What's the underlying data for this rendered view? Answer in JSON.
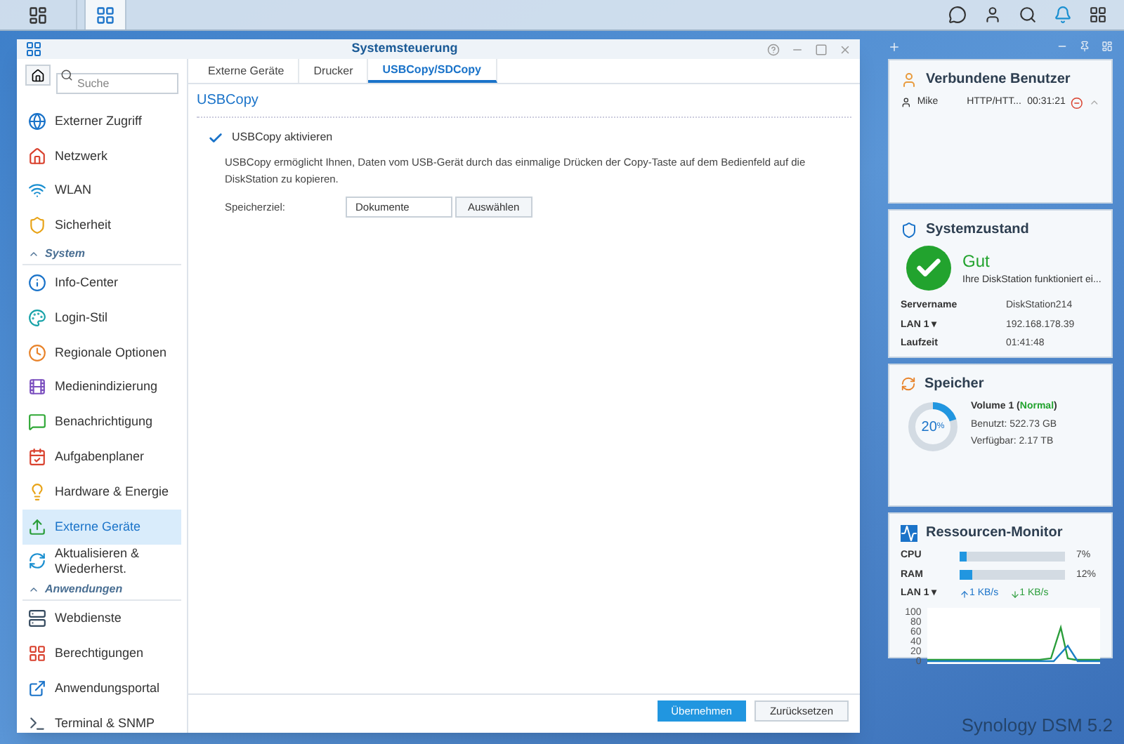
{
  "window": {
    "title": "Systemsteuerung"
  },
  "sidebar": {
    "search": {
      "placeholder": "Suche"
    },
    "items": [
      {
        "kind": "item",
        "label": "Externer Zugriff",
        "selected": false
      },
      {
        "kind": "item",
        "label": "Netzwerk",
        "selected": false
      },
      {
        "kind": "item",
        "label": "WLAN",
        "selected": false
      },
      {
        "kind": "item",
        "label": "Sicherheit",
        "selected": false
      },
      {
        "kind": "section",
        "label": "System"
      },
      {
        "kind": "item",
        "label": "Info-Center",
        "selected": false
      },
      {
        "kind": "item",
        "label": "Login-Stil",
        "selected": false
      },
      {
        "kind": "item",
        "label": "Regionale Optionen",
        "selected": false
      },
      {
        "kind": "item",
        "label": "Medienindizierung",
        "selected": false
      },
      {
        "kind": "item",
        "label": "Benachrichtigung",
        "selected": false
      },
      {
        "kind": "item",
        "label": "Aufgabenplaner",
        "selected": false
      },
      {
        "kind": "item",
        "label": "Hardware & Energie",
        "selected": false
      },
      {
        "kind": "item",
        "label": "Externe Geräte",
        "selected": true
      },
      {
        "kind": "item",
        "label": "Aktualisieren & Wiederherst.",
        "selected": false
      },
      {
        "kind": "section",
        "label": "Anwendungen"
      },
      {
        "kind": "item",
        "label": "Webdienste",
        "selected": false
      },
      {
        "kind": "item",
        "label": "Berechtigungen",
        "selected": false
      },
      {
        "kind": "item",
        "label": "Anwendungsportal",
        "selected": false
      },
      {
        "kind": "item",
        "label": "Terminal & SNMP",
        "selected": false
      }
    ]
  },
  "tabs": [
    {
      "label": "Externe Geräte",
      "selected": false
    },
    {
      "label": "Drucker",
      "selected": false
    },
    {
      "label": "USBCopy/SDCopy",
      "selected": true
    }
  ],
  "section_title": "USBCopy",
  "enable": {
    "label": "USBCopy aktivieren",
    "checked": true
  },
  "description": "USBCopy ermöglicht Ihnen, Daten vom USB-Gerät durch das einmalige Drücken der Copy-Taste auf dem Bedienfeld auf die DiskStation zu kopieren.",
  "destination": {
    "label": "Speicherziel:",
    "value": "Dokumente",
    "button": "Auswählen"
  },
  "buttons": [
    {
      "label": "Übernehmen",
      "kind": "primary"
    },
    {
      "label": "Zurücksetzen",
      "kind": "secondary"
    }
  ],
  "widgets": {
    "users": {
      "title": "Verbundene Benutzer",
      "rows": [
        {
          "name": "Mike",
          "protocol": "HTTP/HTT...",
          "time": "00:31:21"
        }
      ]
    },
    "health": {
      "title": "Systemzustand",
      "status": "Gut",
      "message": "Ihre DiskStation funktioniert ei...",
      "rows": [
        {
          "label": "Servername",
          "value": "DiskStation214"
        },
        {
          "label": "LAN 1 ▾",
          "value": "192.168.178.39"
        },
        {
          "label": "Laufzeit",
          "value": "01:41:48"
        }
      ]
    },
    "storage": {
      "title": "Speicher",
      "level": 0.2,
      "percent": "20",
      "unit": "%",
      "volume": "Volume 1 (**Normal**)",
      "used": "Benutzt: 522.73 GB",
      "free": "Verfügbar: 2.17 TB"
    },
    "monitor": {
      "title": "Ressourcen-Monitor",
      "meters": [
        {
          "label": "CPU",
          "level": 0.07,
          "reading": "7%"
        },
        {
          "label": "RAM",
          "level": 0.12,
          "reading": "12%"
        }
      ],
      "lan": "LAN 1 ▾",
      "up": "1 KB/s",
      "down": "1 KB/s",
      "axis_labels": [
        "100",
        "80",
        "60",
        "40",
        "20",
        "0"
      ]
    }
  },
  "branding": "Synology DSM 5.2"
}
